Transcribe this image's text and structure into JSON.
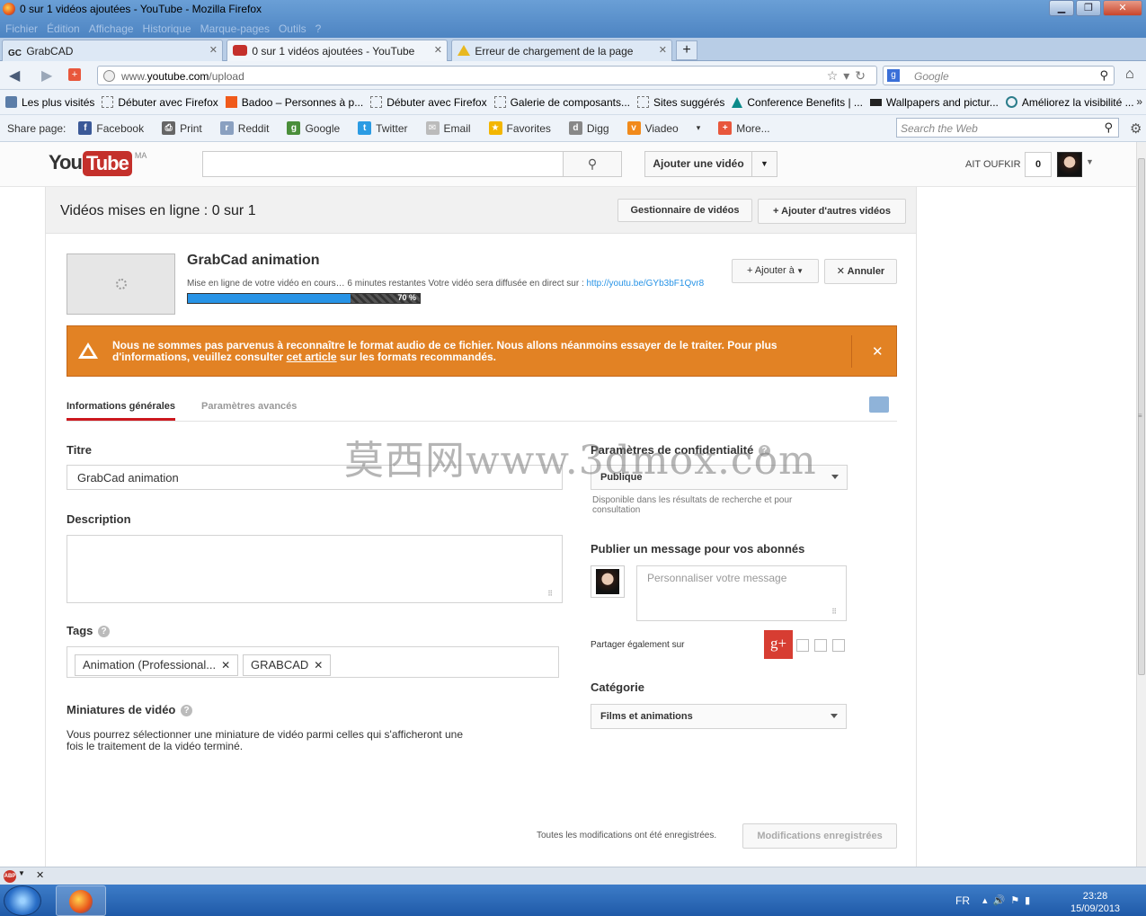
{
  "window": {
    "title": "0 sur 1 vidéos ajoutées - YouTube - Mozilla Firefox",
    "menu": [
      "Fichier",
      "Édition",
      "Affichage",
      "Historique",
      "Marque-pages",
      "Outils",
      "?"
    ],
    "controls": [
      "minimize",
      "maximize",
      "close"
    ]
  },
  "tabs": [
    {
      "label": "GrabCAD",
      "icon": "GC"
    },
    {
      "label": "0 sur 1 vidéos ajoutées - YouTube",
      "icon": "youtube"
    },
    {
      "label": "Erreur de chargement de la page",
      "icon": "warning"
    }
  ],
  "nav": {
    "url_prefix": "www.",
    "url_domain": "youtube.com",
    "url_path": "/upload",
    "search_placeholder": "Google"
  },
  "bookmarks": [
    {
      "label": "Les plus visités",
      "icon": "gear"
    },
    {
      "label": "Débuter avec Firefox",
      "icon": "page"
    },
    {
      "label": "Badoo – Personnes à p...",
      "icon": "badoo"
    },
    {
      "label": "Débuter avec Firefox",
      "icon": "page"
    },
    {
      "label": "Galerie de composants...",
      "icon": "page"
    },
    {
      "label": "Sites suggérés",
      "icon": "page"
    },
    {
      "label": "Conference Benefits | ...",
      "icon": "autodesk"
    },
    {
      "label": "Wallpapers and pictur...",
      "icon": "wallpaper"
    },
    {
      "label": "Améliorez la visibilité ...",
      "icon": "circle"
    }
  ],
  "sharebar": {
    "label": "Share page:",
    "items": [
      {
        "label": "Facebook",
        "color": "#3b5998",
        "glyph": "f"
      },
      {
        "label": "Print",
        "color": "#666666",
        "glyph": "⎙"
      },
      {
        "label": "Reddit",
        "color": "#8aa0c0",
        "glyph": "r"
      },
      {
        "label": "Google",
        "color": "#4a8e3a",
        "glyph": "g"
      },
      {
        "label": "Twitter",
        "color": "#2b9be3",
        "glyph": "t"
      },
      {
        "label": "Email",
        "color": "#bbbbbb",
        "glyph": "✉"
      },
      {
        "label": "Favorites",
        "color": "#f3b600",
        "glyph": "★"
      },
      {
        "label": "Digg",
        "color": "#888888",
        "glyph": "d"
      },
      {
        "label": "Viadeo",
        "color": "#f18a1b",
        "glyph": "v"
      },
      {
        "label": "",
        "color": "transparent",
        "glyph": "▾"
      },
      {
        "label": "More...",
        "color": "#e8573c",
        "glyph": "+"
      }
    ],
    "search_placeholder": "Search the Web"
  },
  "youtube": {
    "logo_you": "You",
    "logo_tube": "Tube",
    "logo_region": "MA",
    "upload_button": "Ajouter une vidéo",
    "username": "AIT OUFKIR",
    "notifications": "0"
  },
  "upload": {
    "header": "Vidéos mises en ligne : 0 sur 1",
    "video_manager_button": "Gestionnaire de vidéos",
    "add_more_button": "Ajouter d'autres vidéos",
    "video_title": "GrabCad animation",
    "status_text": "Mise en ligne de votre vidéo en cours… 6 minutes restantes Votre vidéo sera diffusée en direct sur :",
    "video_link": "http://youtu.be/GYb3bF1Qvr8",
    "progress": 0.7,
    "progress_label": "70 %",
    "add_to_button": "Ajouter à",
    "cancel_button": "Annuler",
    "warning_text_1": "Nous ne sommes pas parvenus à reconnaître le format audio de ce fichier. Nous allons néanmoins essayer de le traiter. Pour plus d'informations, veuillez consulter ",
    "warning_link": "cet article",
    "warning_text_2": " sur les formats recommandés.",
    "tab_general": "Informations générales",
    "tab_advanced": "Paramètres avancés",
    "title_label": "Titre",
    "title_value": "GrabCad animation",
    "description_label": "Description",
    "description_value": "",
    "tags_label": "Tags",
    "tags": [
      "Animation (Professional...",
      "GRABCAD"
    ],
    "thumbnails_label": "Miniatures de vidéo",
    "thumbnails_text": "Vous pourrez sélectionner une miniature de vidéo parmi celles qui s'afficheront une fois le traitement de la vidéo terminé.",
    "privacy_label": "Paramètres de confidentialité",
    "privacy_value": "Publique",
    "privacy_note": "Disponible dans les résultats de recherche et pour consultation",
    "publish_label": "Publier un message pour vos abonnés",
    "message_placeholder": "Personnaliser votre message",
    "share_also_label": "Partager également sur",
    "category_label": "Catégorie",
    "category_value": "Films et animations",
    "saved_status": "Toutes les modifications ont été enregistrées.",
    "saved_button": "Modifications enregistrées"
  },
  "watermark": "莫西网www.3dmox.com",
  "taskbar": {
    "language": "FR",
    "time": "23:28",
    "date": "15/09/2013"
  }
}
